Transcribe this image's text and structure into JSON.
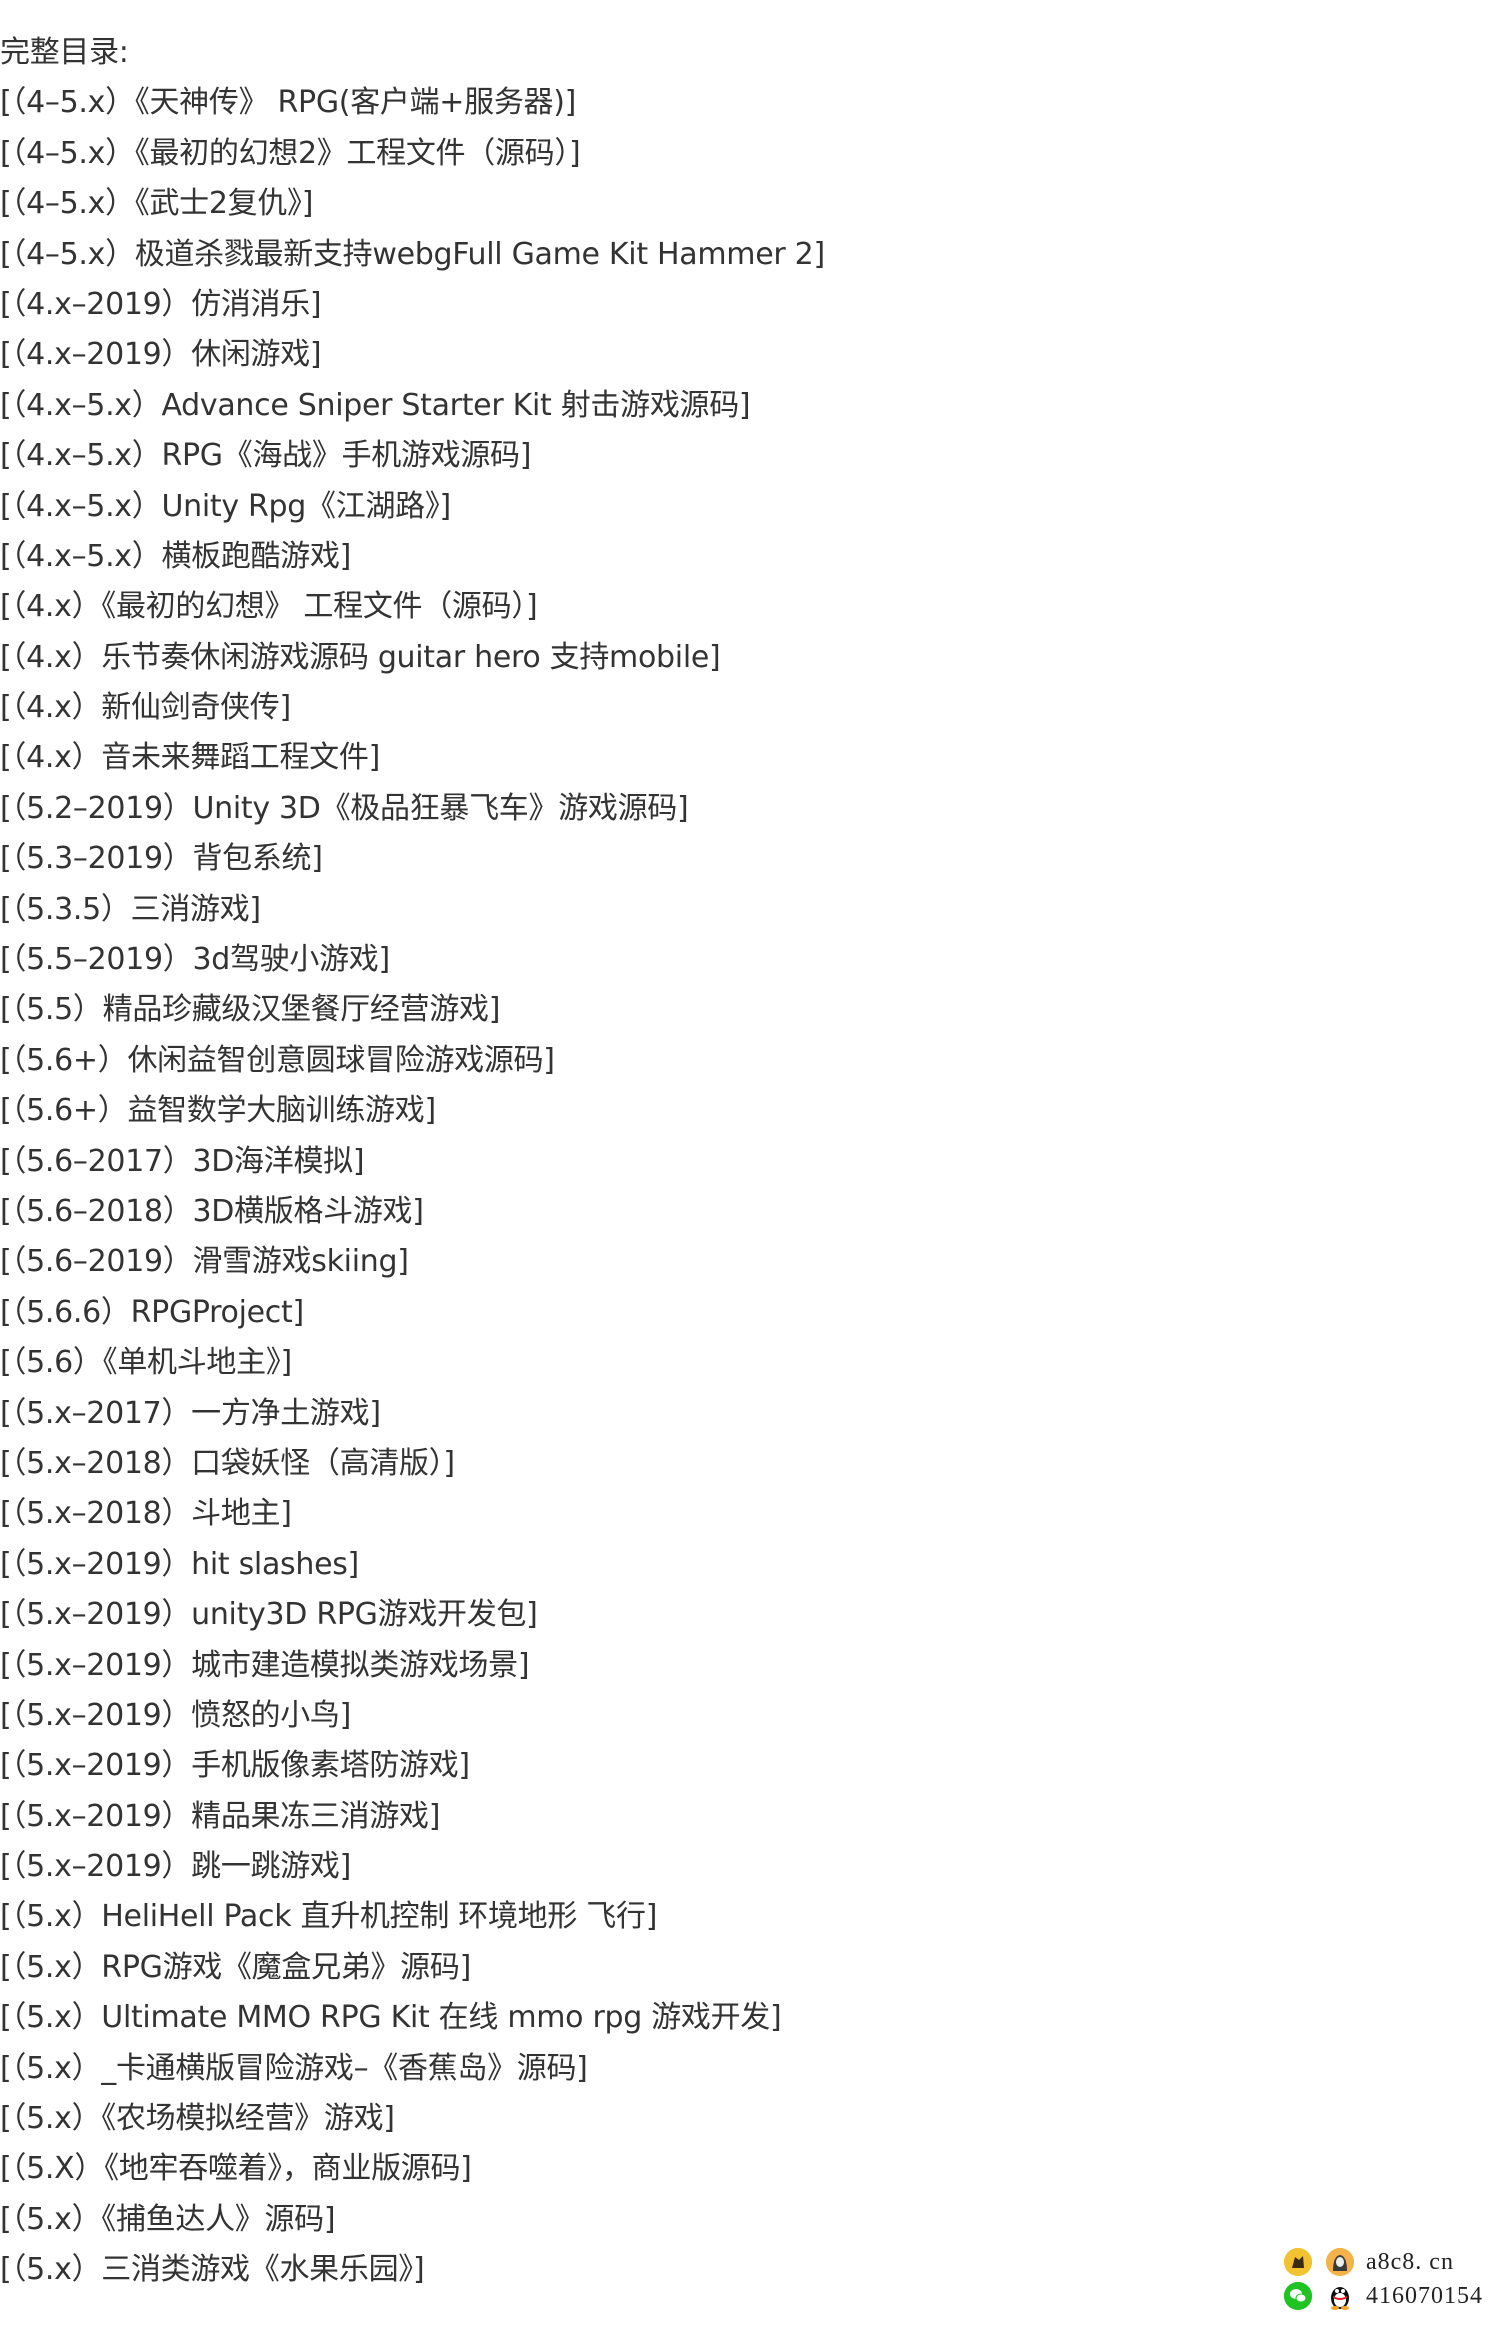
{
  "document": {
    "title": "完整目录:",
    "items": [
      "[（4–5.x）《天神传》 RPG(客户端+服务器)]",
      "[（4–5.x）《最初的幻想2》工程文件（源码）]",
      "[（4–5.x）《武士2复仇》]",
      "[（4–5.x）极道杀戮最新支持webgFull Game Kit Hammer 2]",
      "[（4.x–2019）仿消消乐]",
      "[（4.x–2019）休闲游戏]",
      "[（4.x–5.x）Advance Sniper Starter Kit 射击游戏源码]",
      "[（4.x–5.x）RPG《海战》手机游戏源码]",
      "[（4.x–5.x）Unity Rpg《江湖路》]",
      "[（4.x–5.x）横板跑酷游戏]",
      "[（4.x）《最初的幻想》 工程文件（源码）]",
      "[（4.x）乐节奏休闲游戏源码 guitar hero 支持mobile]",
      "[（4.x）新仙剑奇侠传]",
      "[（4.x）音未来舞蹈工程文件]",
      "[（5.2–2019）Unity 3D《极品狂暴飞车》游戏源码]",
      "[（5.3–2019）背包系统]",
      "[（5.3.5）三消游戏]",
      "[（5.5–2019）3d驾驶小游戏]",
      "[（5.5）精品珍藏级汉堡餐厅经营游戏]",
      "[（5.6+）休闲益智创意圆球冒险游戏源码]",
      "[（5.6+）益智数学大脑训练游戏]",
      "[（5.6–2017）3D海洋模拟]",
      "[（5.6–2018）3D横版格斗游戏]",
      "[（5.6–2019）滑雪游戏skiing]",
      "[（5.6.6）RPGProject]",
      "[（5.6）《单机斗地主》]",
      "[（5.x–2017）一方净土游戏]",
      "[（5.x–2018）口袋妖怪（高清版）]",
      "[（5.x–2018）斗地主]",
      "[（5.x–2019）hit slashes]",
      "[（5.x–2019）unity3D RPG游戏开发包]",
      "[（5.x–2019）城市建造模拟类游戏场景]",
      "[（5.x–2019）愤怒的小鸟]",
      "[（5.x–2019）手机版像素塔防游戏]",
      "[（5.x–2019）精品果冻三消游戏]",
      "[（5.x–2019）跳一跳游戏]",
      "[（5.x）HeliHell Pack 直升机控制 环境地形 飞行]",
      "[（5.x）RPG游戏《魔盒兄弟》源码]",
      "[（5.x）Ultimate MMO RPG Kit 在线 mmo rpg 游戏开发]",
      "[（5.x）_卡通横版冒险游戏–《香蕉岛》源码]",
      "[（5.x）《农场模拟经营》游戏]",
      "[（5.X）《地牢吞噬着》，商业版源码]",
      "[（5.x）《捕鱼达人》源码]",
      "[（5.x）三消类游戏《水果乐园》]"
    ]
  },
  "watermark": {
    "site": "a8c8. cn",
    "qq_number": "416070154",
    "icons": [
      "logo-icon",
      "avatar-icon",
      "wechat-icon",
      "qq-penguin-icon"
    ]
  }
}
